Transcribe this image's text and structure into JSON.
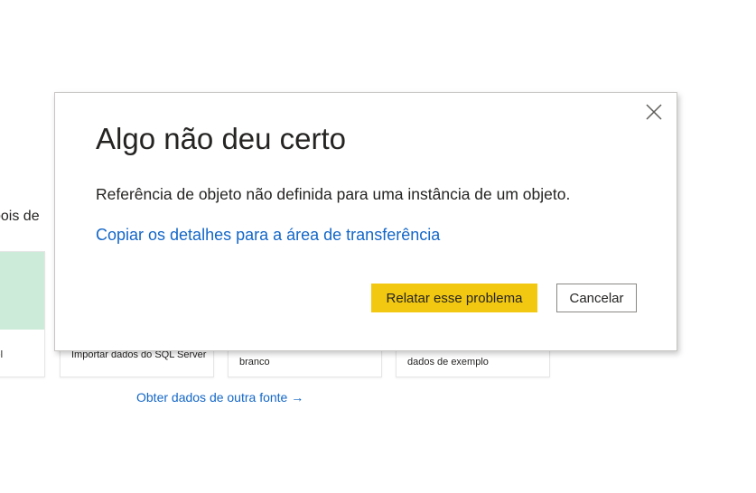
{
  "background": {
    "partial_text": "pois de",
    "cards": [
      {
        "label": "cel"
      },
      {
        "label": "Importar dados do SQL Server"
      },
      {
        "label": "branco"
      },
      {
        "label": "dados de exemplo"
      }
    ],
    "other_source_link": "Obter dados de outra fonte →"
  },
  "dialog": {
    "title": "Algo não deu certo",
    "message": "Referência de objeto não definida para uma instância de um objeto.",
    "copy_details_link": "Copiar os detalhes para a área de transferência",
    "report_button": "Relatar esse problema",
    "cancel_button": "Cancelar",
    "close_icon": "close-icon"
  },
  "colors": {
    "accent_yellow": "#f2c811",
    "link_blue": "#1467c7",
    "text": "#252423",
    "card_green": "#cdebd9"
  }
}
